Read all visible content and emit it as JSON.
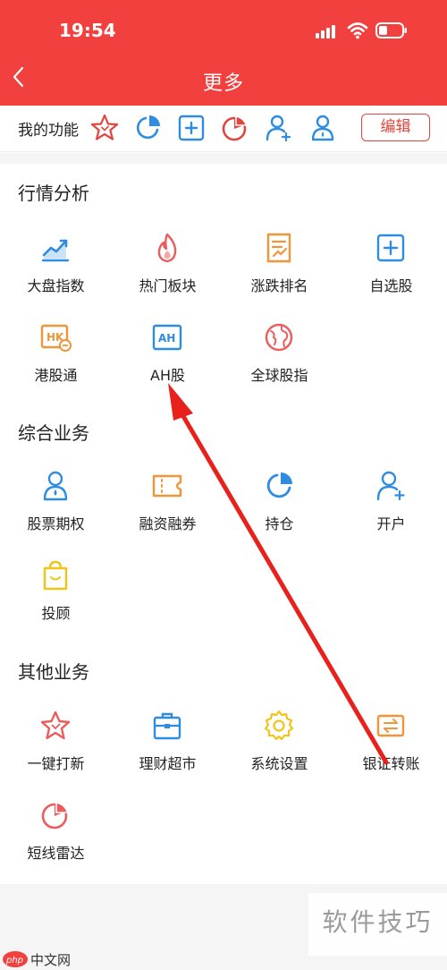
{
  "status": {
    "time": "19:54"
  },
  "nav": {
    "title": "更多"
  },
  "my_functions": {
    "label": "我的功能",
    "icons": [
      "star-icon",
      "pie-icon",
      "plus-square-icon",
      "radar-icon",
      "user-plus-icon",
      "user-drop-icon"
    ],
    "edit_label": "编辑"
  },
  "sections": [
    {
      "title": "行情分析",
      "items": [
        {
          "label": "大盘指数",
          "icon": "trend-chart-icon"
        },
        {
          "label": "热门板块",
          "icon": "flame-icon"
        },
        {
          "label": "涨跌排名",
          "icon": "ranking-doc-icon"
        },
        {
          "label": "自选股",
          "icon": "plus-square-icon"
        },
        {
          "label": "港股通",
          "icon": "hk-icon"
        },
        {
          "label": "AH股",
          "icon": "ah-icon"
        },
        {
          "label": "全球股指",
          "icon": "globe-icon"
        }
      ]
    },
    {
      "title": "综合业务",
      "items": [
        {
          "label": "股票期权",
          "icon": "user-drop-icon"
        },
        {
          "label": "融资融券",
          "icon": "ticket-icon"
        },
        {
          "label": "持仓",
          "icon": "pie-icon"
        },
        {
          "label": "开户",
          "icon": "user-plus-icon"
        },
        {
          "label": "投顾",
          "icon": "bag-icon"
        }
      ]
    },
    {
      "title": "其他业务",
      "items": [
        {
          "label": "一键打新",
          "icon": "star-icon"
        },
        {
          "label": "理财超市",
          "icon": "briefcase-icon"
        },
        {
          "label": "系统设置",
          "icon": "gear-icon"
        },
        {
          "label": "银证转账",
          "icon": "transfer-icon"
        },
        {
          "label": "短线雷达",
          "icon": "radar-icon"
        }
      ]
    }
  ],
  "watermark": {
    "right_text": "软件技巧",
    "left_text": "中文网",
    "left_logo_text": "php"
  },
  "colors": {
    "header": "#f2403f",
    "red": "#e0463f",
    "blue": "#2e8de0",
    "orange": "#f0953a",
    "yellow": "#f2c418",
    "pink": "#ec5c5c"
  }
}
